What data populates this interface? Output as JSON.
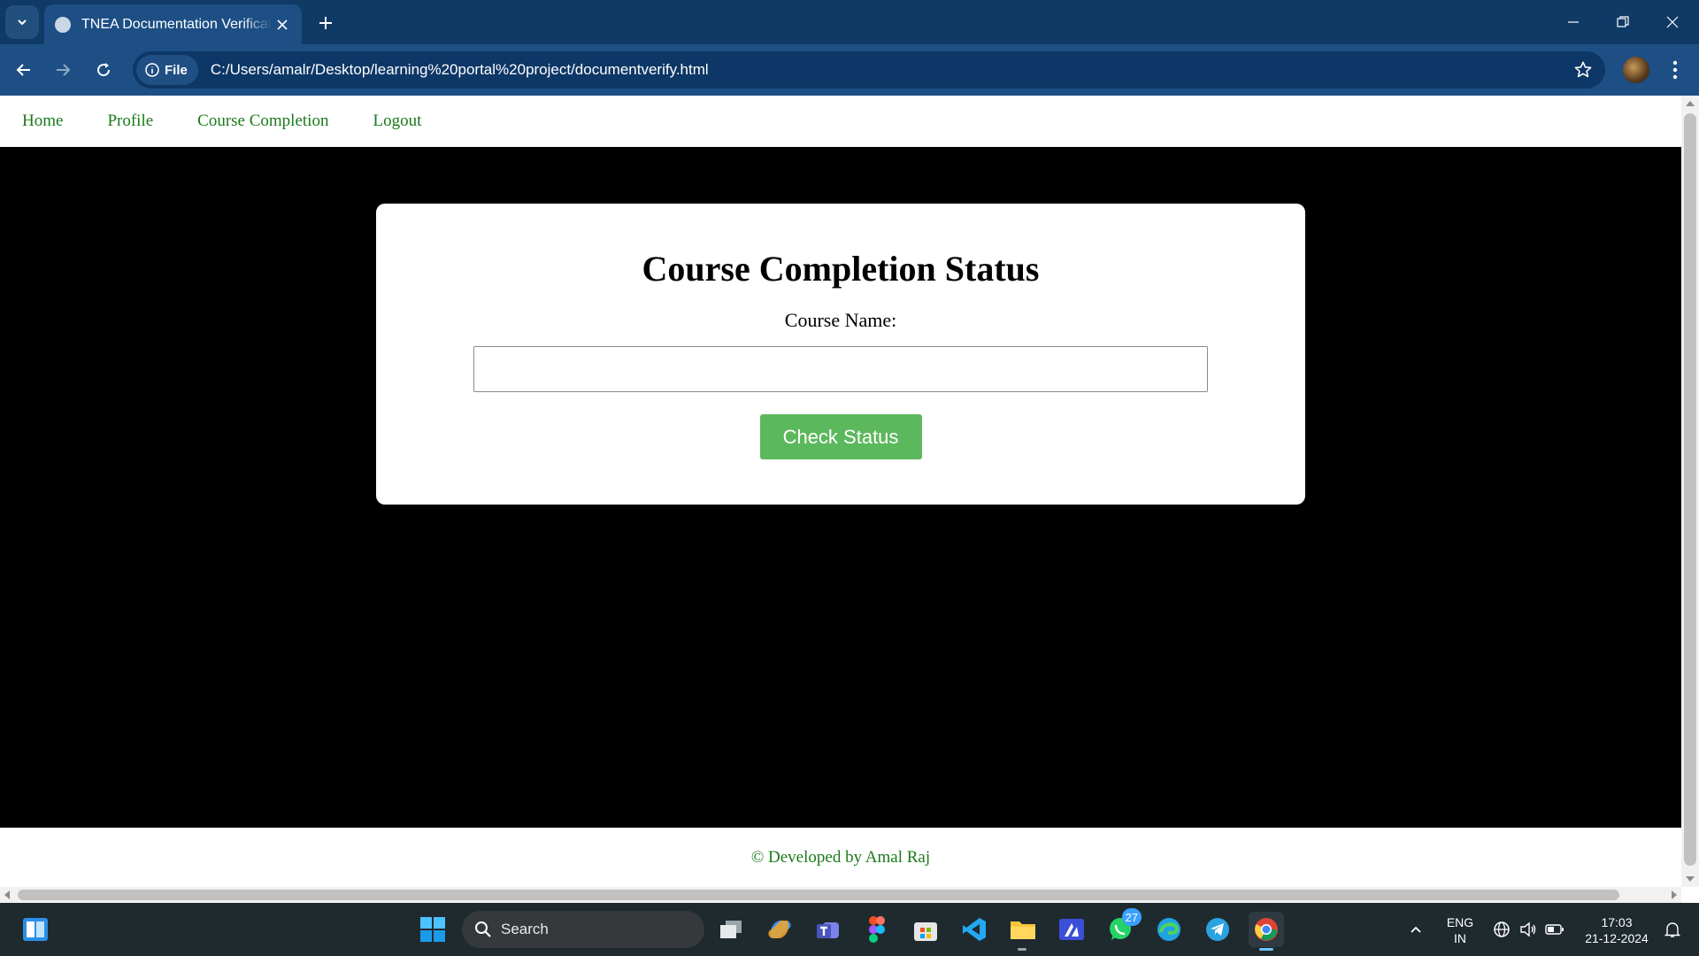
{
  "browser": {
    "tab_title": "TNEA Documentation Verification",
    "address_chip": "File",
    "url": "C:/Users/amalr/Desktop/learning%20portal%20project/documentverify.html"
  },
  "nav": {
    "items": [
      {
        "label": "Home"
      },
      {
        "label": "Profile"
      },
      {
        "label": "Course Completion"
      },
      {
        "label": "Logout"
      }
    ]
  },
  "main": {
    "heading": "Course Completion Status",
    "course_name_label": "Course Name:",
    "course_name_value": "",
    "course_name_placeholder": "",
    "submit_label": "Check Status"
  },
  "footer": {
    "text": "© Developed by Amal Raj"
  },
  "taskbar": {
    "search_label": "Search",
    "whatsapp_badge": "27",
    "language_line1": "ENG",
    "language_line2": "IN",
    "time": "17:03",
    "date": "21-12-2024",
    "pinned_icons": [
      "task-view-icon",
      "copilot-icon",
      "teams-icon",
      "figma-icon",
      "store-icon",
      "vscode-icon",
      "file-explorer-icon",
      "app-icon",
      "whatsapp-icon",
      "edge-icon",
      "telegram-icon",
      "chrome-icon"
    ]
  },
  "colors": {
    "nav_link": "#1a7a1a",
    "button_bg": "#5cb85c",
    "page_bg": "#000000",
    "chrome_dark": "#0f3a66",
    "chrome_toolbar": "#1d4f85"
  }
}
